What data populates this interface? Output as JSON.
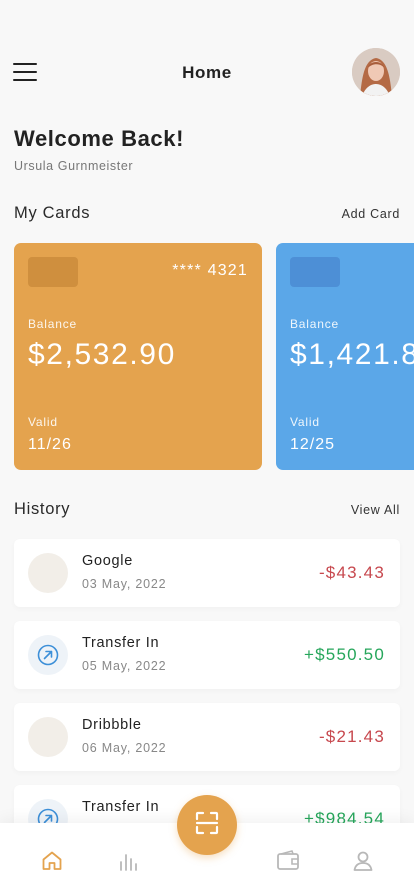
{
  "header": {
    "title": "Home",
    "menu_icon": "menu-icon",
    "avatar_icon": "avatar"
  },
  "welcome": {
    "title": "Welcome Back!",
    "name": "Ursula Gurnmeister"
  },
  "cards_section": {
    "title": "My Cards",
    "action": "Add Card",
    "cards": [
      {
        "number": "**** 4321",
        "balance_label": "Balance",
        "balance": "$2,532.90",
        "valid_label": "Valid",
        "valid": "11/26",
        "color": "#e4a34e"
      },
      {
        "number": "",
        "balance_label": "Balance",
        "balance": "$1,421.8",
        "valid_label": "Valid",
        "valid": "12/25",
        "color": "#5ba7e8"
      }
    ]
  },
  "history": {
    "title": "History",
    "action": "View All",
    "items": [
      {
        "name": "Google",
        "date": "03 May, 2022",
        "amount": "-$43.43",
        "type": "negative",
        "icon": "google-logo"
      },
      {
        "name": "Transfer In",
        "date": "05 May, 2022",
        "amount": "+$550.50",
        "type": "positive",
        "icon": "arrow-up-right-icon"
      },
      {
        "name": "Dribbble",
        "date": "06 May, 2022",
        "amount": "-$21.43",
        "type": "negative",
        "icon": "dribbble-logo"
      },
      {
        "name": "Transfer In",
        "date": "",
        "amount": "+$984.54",
        "type": "positive",
        "icon": "arrow-up-right-icon"
      }
    ]
  },
  "nav": {
    "items": [
      "home-icon",
      "stats-icon",
      "scan-icon",
      "wallet-icon",
      "profile-icon"
    ],
    "active": "home-icon"
  },
  "colors": {
    "accent": "#e4a34e",
    "blue_card": "#5ba7e8",
    "positive": "#26a65b",
    "negative": "#c7484e"
  }
}
